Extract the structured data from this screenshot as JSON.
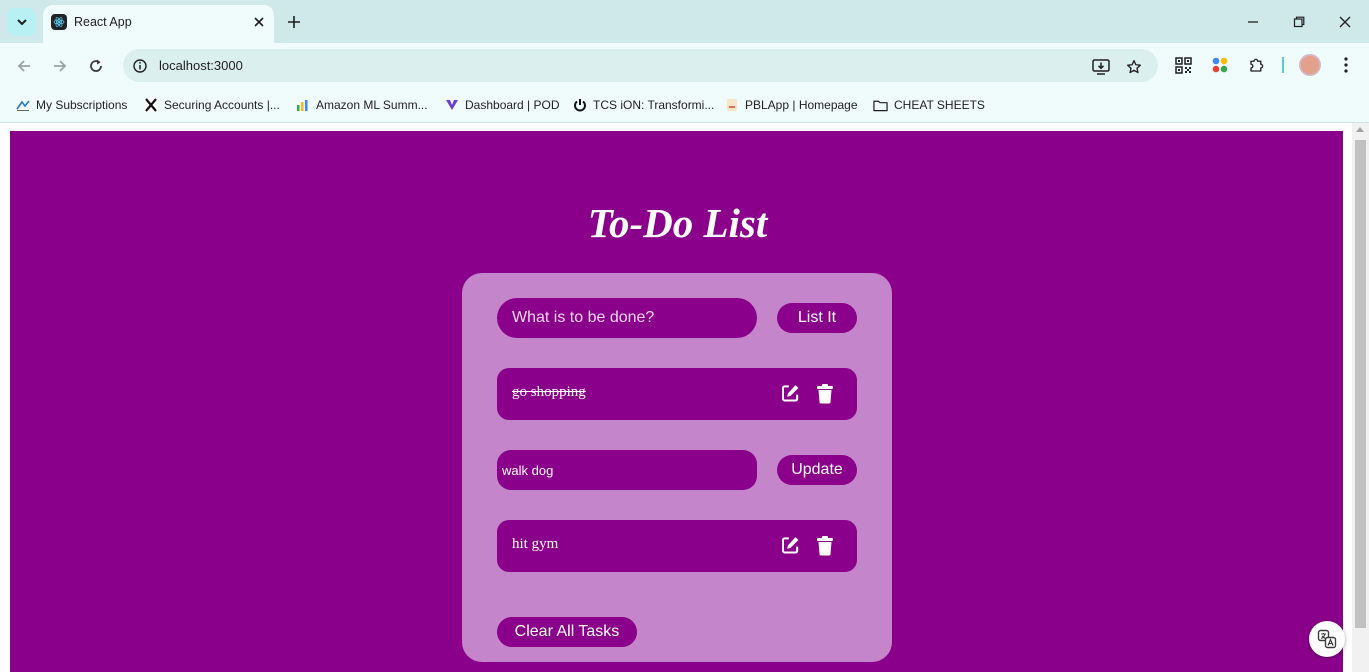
{
  "browser": {
    "tab_title": "React App",
    "url": "localhost:3000",
    "bookmarks": [
      {
        "label": "My Subscriptions",
        "icon": "subscriptions-icon"
      },
      {
        "label": "Securing Accounts |...",
        "icon": "x-logo-icon"
      },
      {
        "label": "Amazon ML Summ...",
        "icon": "bar-chart-icon"
      },
      {
        "label": "Dashboard | POD",
        "icon": "pod-logo-icon"
      },
      {
        "label": "TCS iON: Transformi...",
        "icon": "power-icon"
      },
      {
        "label": "PBLApp | Homepage",
        "icon": "pbl-logo-icon"
      },
      {
        "label": "CHEAT SHEETS",
        "icon": "folder-icon"
      }
    ]
  },
  "app": {
    "title": "To-Do List",
    "input_placeholder": "What is to be done?",
    "add_button_label": "List It",
    "tasks": [
      {
        "text": "go shopping",
        "completed": true,
        "editing": false
      },
      {
        "text": "walk dog",
        "completed": false,
        "editing": true
      },
      {
        "text": "hit gym",
        "completed": false,
        "editing": false
      }
    ],
    "update_button_label": "Update",
    "clear_button_label": "Clear All Tasks"
  },
  "colors": {
    "app_background": "#8b008b",
    "card_background": "#c585cb",
    "text": "#ffffff"
  }
}
